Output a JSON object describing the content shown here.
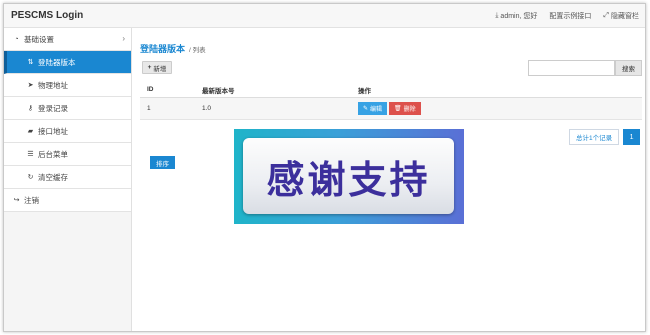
{
  "app": {
    "title": "PESCMS Login"
  },
  "topbar": {
    "links": [
      {
        "icon": "download-icon",
        "label": "admin, 您好"
      },
      {
        "icon": "",
        "label": "配置示例接口"
      },
      {
        "icon": "expand-icon",
        "label": "隐藏窗栏"
      }
    ]
  },
  "sidebar": {
    "items": [
      {
        "label": "基础设置",
        "icon": "dashboard-icon",
        "type": "group"
      },
      {
        "label": "登陆器版本",
        "icon": "sort-icon",
        "type": "sub",
        "active": true
      },
      {
        "label": "物理地址",
        "icon": "location-arrow-icon",
        "type": "sub"
      },
      {
        "label": "登录记录",
        "icon": "key-icon",
        "type": "sub"
      },
      {
        "label": "接口地址",
        "icon": "book-icon",
        "type": "sub"
      },
      {
        "label": "后台菜单",
        "icon": "list-icon",
        "type": "sub"
      },
      {
        "label": "清空缓存",
        "icon": "refresh-icon",
        "type": "sub"
      },
      {
        "label": "注销",
        "icon": "sign-out-icon",
        "type": "group"
      }
    ]
  },
  "page": {
    "title": "登陆器版本",
    "subtitle": "/ 列表"
  },
  "toolbar": {
    "add_label": "新增",
    "search_placeholder": "",
    "search_value": "",
    "search_button": "搜索"
  },
  "table": {
    "headers": [
      "ID",
      "最新版本号",
      "操作"
    ],
    "rows": [
      {
        "id": "1",
        "version": "1.0",
        "edit_label": "编辑",
        "delete_label": "删除"
      }
    ]
  },
  "pagination": {
    "total_label": "总计1个记录",
    "current_page": "1"
  },
  "sort_button": "排序",
  "overlay": {
    "text": "感谢支持"
  },
  "colors": {
    "accent": "#1a87d1",
    "danger": "#dd514c",
    "info": "#37a2e4"
  }
}
